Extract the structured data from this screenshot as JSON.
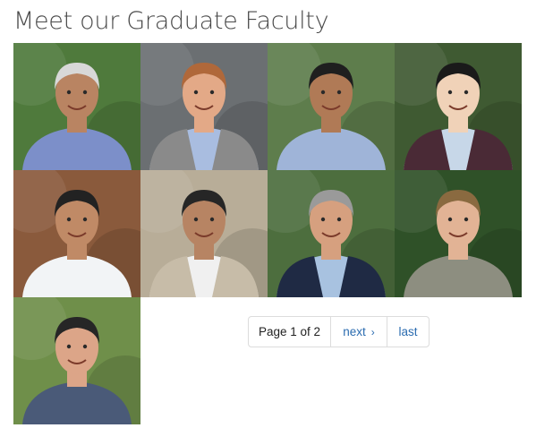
{
  "page": {
    "title": "Meet our Graduate Faculty"
  },
  "faculty": [
    {
      "bg": "#4f7a3c",
      "skin": "#b98462",
      "hair": "#d8d8d8",
      "shirt": "#7c8fc9",
      "jacket": ""
    },
    {
      "bg": "#6b6f72",
      "skin": "#e3a987",
      "hair": "#b0683a",
      "shirt": "#a9bde0",
      "jacket": "#8a8a8a"
    },
    {
      "bg": "#5e7d4c",
      "skin": "#b07a56",
      "hair": "#1f1f1f",
      "shirt": "#9fb4d8",
      "jacket": ""
    },
    {
      "bg": "#3f5a32",
      "skin": "#f0d2b8",
      "hair": "#1a1a1a",
      "shirt": "#c7d7e8",
      "jacket": "#4a2a36"
    },
    {
      "bg": "#8a5a3c",
      "skin": "#c08a66",
      "hair": "#222222",
      "shirt": "#f2f4f6",
      "jacket": ""
    },
    {
      "bg": "#b8ad98",
      "skin": "#b78463",
      "hair": "#262626",
      "shirt": "#f0f0f0",
      "jacket": "#c7bca8"
    },
    {
      "bg": "#4d6e3e",
      "skin": "#d6a07f",
      "hair": "#9a9a9a",
      "shirt": "#a8c2e0",
      "jacket": "#1f2a44"
    },
    {
      "bg": "#2f5128",
      "skin": "#e2b395",
      "hair": "#8a6a40",
      "shirt": "#8d8e80",
      "jacket": ""
    },
    {
      "bg": "#6f8f4a",
      "skin": "#dca588",
      "hair": "#262626",
      "shirt": "#4a5a78",
      "jacket": ""
    }
  ],
  "pager": {
    "current": "Page 1 of 2",
    "next": "next",
    "next_arrow": "›",
    "last": "last"
  }
}
